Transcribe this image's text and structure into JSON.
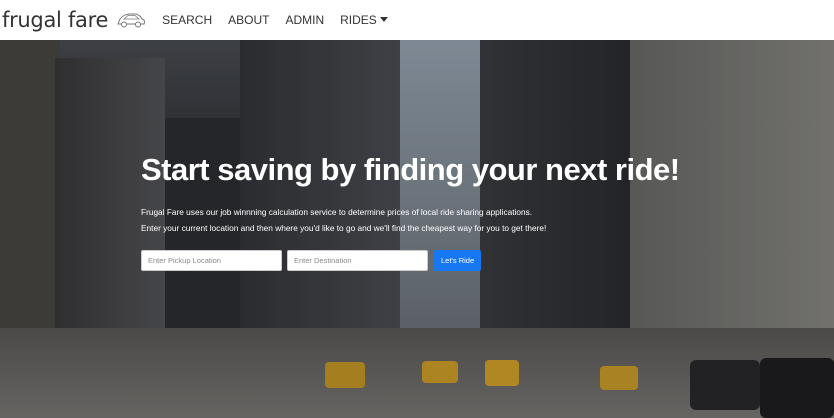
{
  "navbar": {
    "brand": "frugal fare",
    "brand_icon": "car-icon",
    "links": [
      "SEARCH",
      "ABOUT",
      "ADMIN",
      "RIDES"
    ]
  },
  "hero": {
    "title": "Start saving by finding your next ride!",
    "description_line1": "Frugal Fare uses our job winnning calculation service to determine prices of local ride sharing applications.",
    "description_line2": "Enter your current location and then where you'd like to go and we'll find the cheapest way for you to get there!",
    "pickup_placeholder": "Enter Pickup Location",
    "destination_placeholder": "Enter Destination",
    "submit_label": "Let's Ride"
  },
  "colors": {
    "button": "#1877f2"
  }
}
